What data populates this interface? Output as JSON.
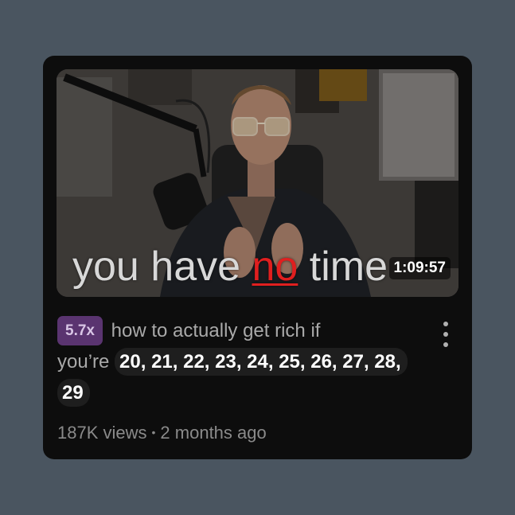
{
  "video": {
    "thumbnail_caption_pre": "you have ",
    "thumbnail_caption_highlight": "no",
    "thumbnail_caption_post": " time",
    "duration": "1:09:57",
    "speed_badge": "5.7x",
    "title_plain_1": "how to actually get rich if",
    "title_plain_2": "you’re",
    "title_highlight": "20, 21, 22, 23, 24, 25, 26, 27, 28, 29",
    "views": "187K views",
    "separator": "•",
    "age": "2 months ago"
  },
  "icons": {
    "menu": "kebab-menu-icon"
  },
  "colors": {
    "page_bg": "#4a5560",
    "card_bg": "#0d0d0d",
    "badge_bg": "#5a3470",
    "caption_highlight": "#e01f1f"
  }
}
